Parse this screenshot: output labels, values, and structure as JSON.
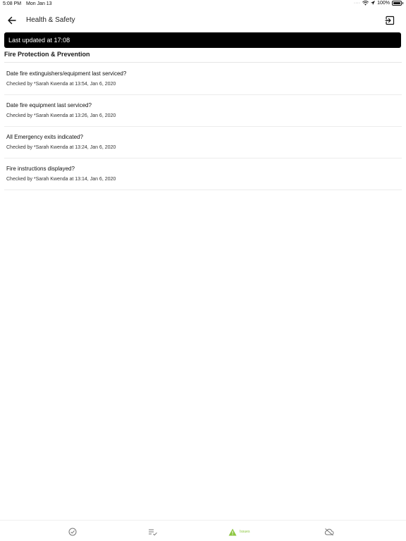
{
  "status_bar": {
    "time": "5:08 PM",
    "date": "Mon Jan 13",
    "battery": "100%",
    "icons": [
      "wifi-icon",
      "location-icon",
      "battery-icon"
    ]
  },
  "nav": {
    "title": "Health & Safety",
    "back_icon": "back-arrow-icon",
    "exit_icon": "exit-icon"
  },
  "banner": {
    "text": "Last updated at 17:08"
  },
  "section": {
    "title": "Fire Protection & Prevention"
  },
  "items": [
    {
      "question": "Date fire extinguishers/equipment last serviced?",
      "checked": "Checked by *Sarah Kwenda at 13:54, Jan 6, 2020"
    },
    {
      "question": "Date fire equipment last serviced?",
      "checked": "Checked by *Sarah Kwenda at 13:26, Jan 6, 2020"
    },
    {
      "question": "All Emergency exits indicated?",
      "checked": "Checked by *Sarah Kwenda at 13:24, Jan 6, 2020"
    },
    {
      "question": "Fire instructions displayed?",
      "checked": "Checked by *Sarah Kwenda at 13:14, Jan 6, 2020"
    }
  ],
  "tabs": [
    {
      "name": "checks",
      "icon": "check-circle-icon"
    },
    {
      "name": "list",
      "icon": "checklist-icon"
    },
    {
      "name": "issues",
      "icon": "warning-icon",
      "label": "Issues"
    },
    {
      "name": "sync",
      "icon": "cloud-off-icon"
    }
  ],
  "colors": {
    "banner_bg": "#000000",
    "issues_accent": "#8cc63f"
  }
}
